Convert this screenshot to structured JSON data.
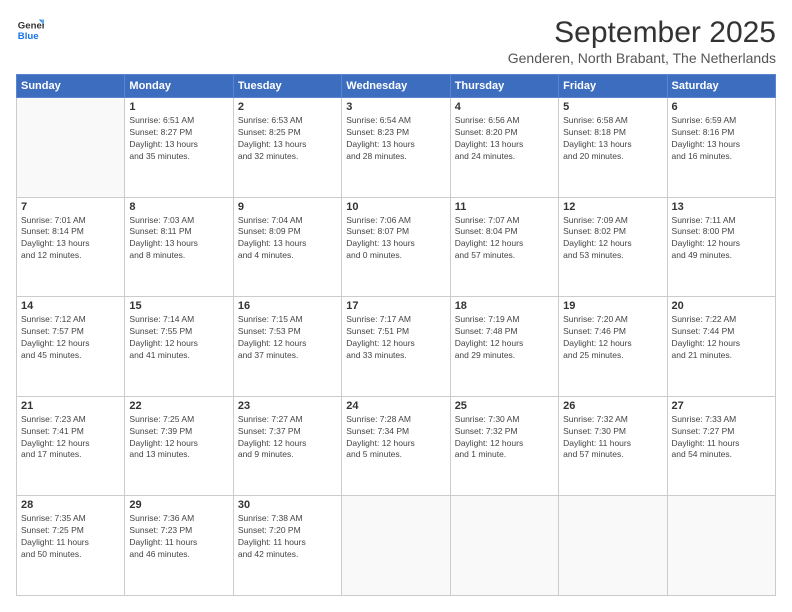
{
  "logo": {
    "line1": "General",
    "line2": "Blue"
  },
  "title": "September 2025",
  "subtitle": "Genderen, North Brabant, The Netherlands",
  "headers": [
    "Sunday",
    "Monday",
    "Tuesday",
    "Wednesday",
    "Thursday",
    "Friday",
    "Saturday"
  ],
  "weeks": [
    [
      {
        "num": "",
        "info": ""
      },
      {
        "num": "1",
        "info": "Sunrise: 6:51 AM\nSunset: 8:27 PM\nDaylight: 13 hours\nand 35 minutes."
      },
      {
        "num": "2",
        "info": "Sunrise: 6:53 AM\nSunset: 8:25 PM\nDaylight: 13 hours\nand 32 minutes."
      },
      {
        "num": "3",
        "info": "Sunrise: 6:54 AM\nSunset: 8:23 PM\nDaylight: 13 hours\nand 28 minutes."
      },
      {
        "num": "4",
        "info": "Sunrise: 6:56 AM\nSunset: 8:20 PM\nDaylight: 13 hours\nand 24 minutes."
      },
      {
        "num": "5",
        "info": "Sunrise: 6:58 AM\nSunset: 8:18 PM\nDaylight: 13 hours\nand 20 minutes."
      },
      {
        "num": "6",
        "info": "Sunrise: 6:59 AM\nSunset: 8:16 PM\nDaylight: 13 hours\nand 16 minutes."
      }
    ],
    [
      {
        "num": "7",
        "info": "Sunrise: 7:01 AM\nSunset: 8:14 PM\nDaylight: 13 hours\nand 12 minutes."
      },
      {
        "num": "8",
        "info": "Sunrise: 7:03 AM\nSunset: 8:11 PM\nDaylight: 13 hours\nand 8 minutes."
      },
      {
        "num": "9",
        "info": "Sunrise: 7:04 AM\nSunset: 8:09 PM\nDaylight: 13 hours\nand 4 minutes."
      },
      {
        "num": "10",
        "info": "Sunrise: 7:06 AM\nSunset: 8:07 PM\nDaylight: 13 hours\nand 0 minutes."
      },
      {
        "num": "11",
        "info": "Sunrise: 7:07 AM\nSunset: 8:04 PM\nDaylight: 12 hours\nand 57 minutes."
      },
      {
        "num": "12",
        "info": "Sunrise: 7:09 AM\nSunset: 8:02 PM\nDaylight: 12 hours\nand 53 minutes."
      },
      {
        "num": "13",
        "info": "Sunrise: 7:11 AM\nSunset: 8:00 PM\nDaylight: 12 hours\nand 49 minutes."
      }
    ],
    [
      {
        "num": "14",
        "info": "Sunrise: 7:12 AM\nSunset: 7:57 PM\nDaylight: 12 hours\nand 45 minutes."
      },
      {
        "num": "15",
        "info": "Sunrise: 7:14 AM\nSunset: 7:55 PM\nDaylight: 12 hours\nand 41 minutes."
      },
      {
        "num": "16",
        "info": "Sunrise: 7:15 AM\nSunset: 7:53 PM\nDaylight: 12 hours\nand 37 minutes."
      },
      {
        "num": "17",
        "info": "Sunrise: 7:17 AM\nSunset: 7:51 PM\nDaylight: 12 hours\nand 33 minutes."
      },
      {
        "num": "18",
        "info": "Sunrise: 7:19 AM\nSunset: 7:48 PM\nDaylight: 12 hours\nand 29 minutes."
      },
      {
        "num": "19",
        "info": "Sunrise: 7:20 AM\nSunset: 7:46 PM\nDaylight: 12 hours\nand 25 minutes."
      },
      {
        "num": "20",
        "info": "Sunrise: 7:22 AM\nSunset: 7:44 PM\nDaylight: 12 hours\nand 21 minutes."
      }
    ],
    [
      {
        "num": "21",
        "info": "Sunrise: 7:23 AM\nSunset: 7:41 PM\nDaylight: 12 hours\nand 17 minutes."
      },
      {
        "num": "22",
        "info": "Sunrise: 7:25 AM\nSunset: 7:39 PM\nDaylight: 12 hours\nand 13 minutes."
      },
      {
        "num": "23",
        "info": "Sunrise: 7:27 AM\nSunset: 7:37 PM\nDaylight: 12 hours\nand 9 minutes."
      },
      {
        "num": "24",
        "info": "Sunrise: 7:28 AM\nSunset: 7:34 PM\nDaylight: 12 hours\nand 5 minutes."
      },
      {
        "num": "25",
        "info": "Sunrise: 7:30 AM\nSunset: 7:32 PM\nDaylight: 12 hours\nand 1 minute."
      },
      {
        "num": "26",
        "info": "Sunrise: 7:32 AM\nSunset: 7:30 PM\nDaylight: 11 hours\nand 57 minutes."
      },
      {
        "num": "27",
        "info": "Sunrise: 7:33 AM\nSunset: 7:27 PM\nDaylight: 11 hours\nand 54 minutes."
      }
    ],
    [
      {
        "num": "28",
        "info": "Sunrise: 7:35 AM\nSunset: 7:25 PM\nDaylight: 11 hours\nand 50 minutes."
      },
      {
        "num": "29",
        "info": "Sunrise: 7:36 AM\nSunset: 7:23 PM\nDaylight: 11 hours\nand 46 minutes."
      },
      {
        "num": "30",
        "info": "Sunrise: 7:38 AM\nSunset: 7:20 PM\nDaylight: 11 hours\nand 42 minutes."
      },
      {
        "num": "",
        "info": ""
      },
      {
        "num": "",
        "info": ""
      },
      {
        "num": "",
        "info": ""
      },
      {
        "num": "",
        "info": ""
      }
    ]
  ]
}
